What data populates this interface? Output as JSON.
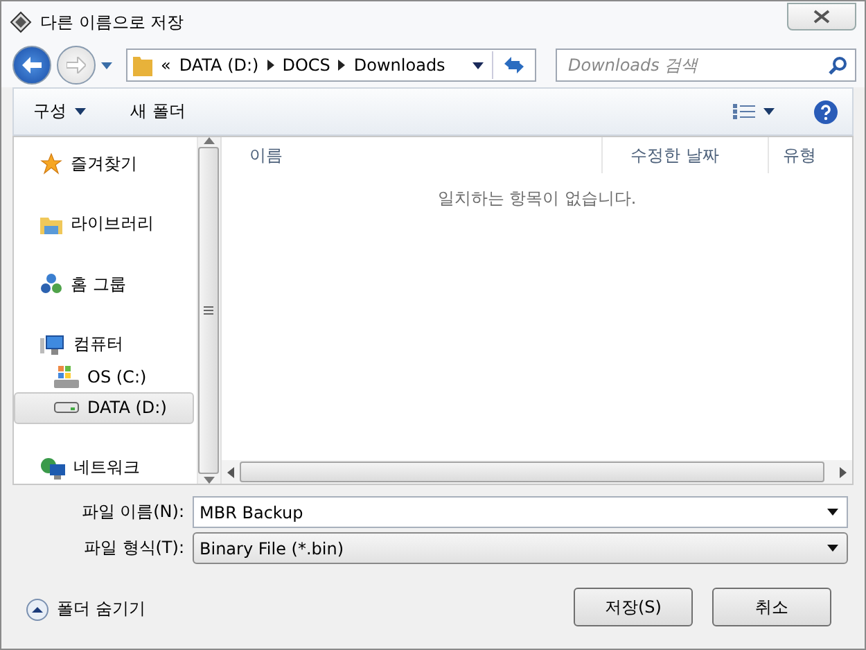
{
  "window": {
    "title": "다른 이름으로 저장"
  },
  "address": {
    "overflow": "«",
    "path": [
      "DATA (D:)",
      "DOCS",
      "Downloads"
    ]
  },
  "search": {
    "placeholder": "Downloads 검색"
  },
  "toolbar": [
    {
      "label": "구성",
      "dropdown": true
    },
    {
      "label": "새 폴더",
      "dropdown": false
    }
  ],
  "sidebar": {
    "items": [
      {
        "kind": "favorites",
        "label": "즐겨찾기",
        "selected": false
      },
      {
        "kind": "library",
        "label": "라이브러리",
        "selected": false
      },
      {
        "kind": "homegroup",
        "label": "홈 그룹",
        "selected": false
      },
      {
        "kind": "computer",
        "label": "컴퓨터",
        "selected": false,
        "children": [
          {
            "kind": "system-drive",
            "label": "OS (C:)",
            "selected": false
          },
          {
            "kind": "drive",
            "label": "DATA (D:)",
            "selected": true
          }
        ]
      },
      {
        "kind": "network",
        "label": "네트워크",
        "selected": false
      }
    ]
  },
  "table": {
    "columns": [
      "이름",
      "수정한 날짜",
      "유형"
    ],
    "empty_message": "일치하는 항목이 없습니다."
  },
  "form": {
    "file_name": {
      "label": "파일 이름(N):",
      "value": "MBR Backup"
    },
    "file_type": {
      "label": "파일 형식(T):",
      "value": "Binary File (*.bin)"
    }
  },
  "hide_folders": "폴더 숨기기",
  "buttons": [
    "저장(S)",
    "취소"
  ]
}
